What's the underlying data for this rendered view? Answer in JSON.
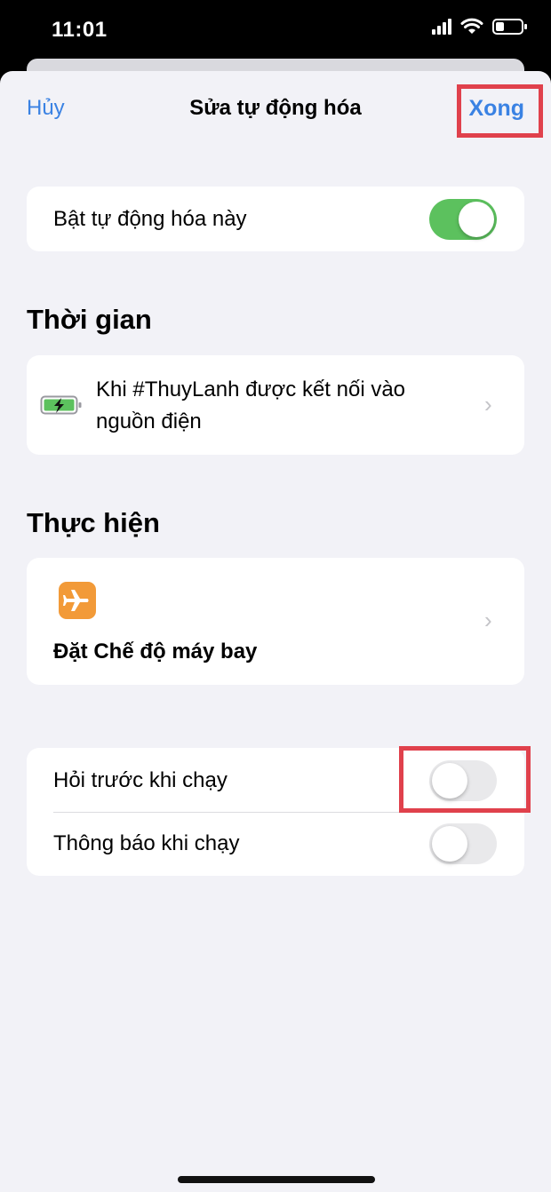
{
  "status": {
    "time": "11:01"
  },
  "nav": {
    "cancel": "Hủy",
    "title": "Sửa tự động hóa",
    "done": "Xong"
  },
  "enable_row": {
    "label": "Bật tự động hóa này",
    "enabled": true
  },
  "time_section": {
    "title": "Thời gian",
    "trigger_line1": "Khi #ThuyLanh được kết nối vào",
    "trigger_line2": "nguồn điện",
    "icon": "battery-charging-icon"
  },
  "action_section": {
    "title": "Thực hiện",
    "action_label": "Đặt Chế độ máy bay",
    "icon": "airplane-icon",
    "icon_color": "#f29a38"
  },
  "options": {
    "ask_before_running": {
      "label": "Hỏi trước khi chạy",
      "enabled": false
    },
    "notify_when_run": {
      "label": "Thông báo khi chạy",
      "enabled": false
    }
  },
  "colors": {
    "accent": "#3a82e3",
    "toggle_on": "#5cc15e",
    "highlight": "#e0414c"
  }
}
